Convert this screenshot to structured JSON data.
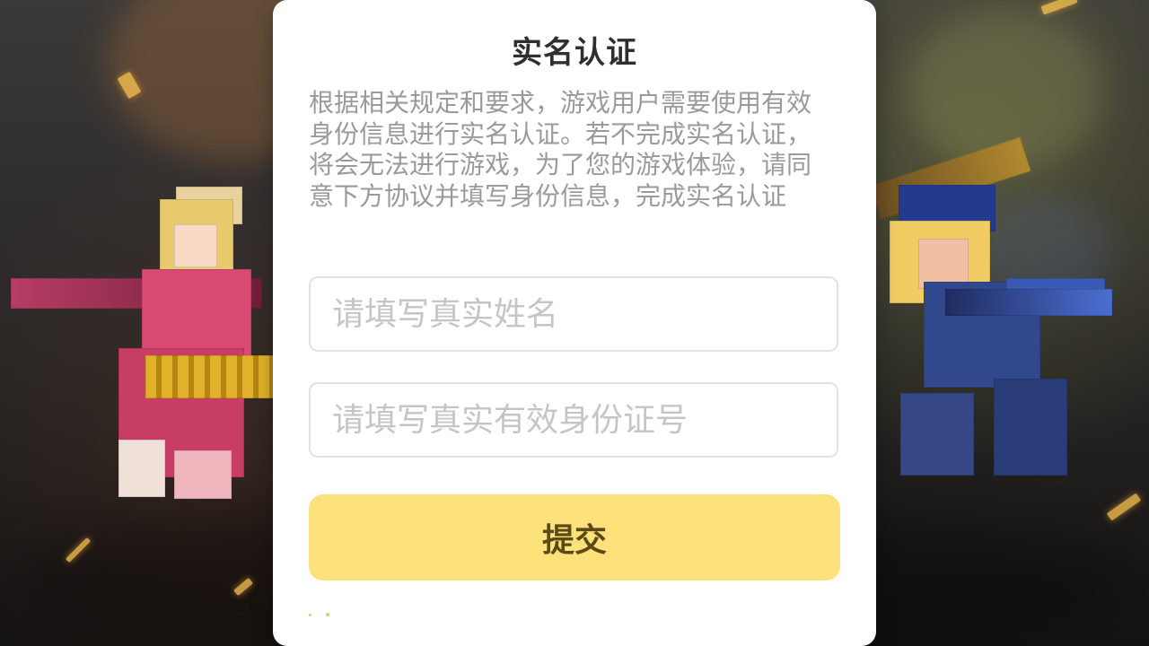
{
  "dialog": {
    "title": "实名认证",
    "description": "根据相关规定和要求，游戏用户需要使用有效身份信息进行实名认证。若不完成实名认证，将会无法进行游戏，为了您的游戏体验，请同意下方协议并填写身份信息，完成实名认证"
  },
  "form": {
    "name_placeholder": "请填写真实姓名",
    "id_placeholder": "请填写真实有效身份证号",
    "submit_label": "提交"
  },
  "colors": {
    "dialog_bg": "#ffffff",
    "submit_bg": "#fde27b",
    "submit_text": "#5c4a16"
  }
}
